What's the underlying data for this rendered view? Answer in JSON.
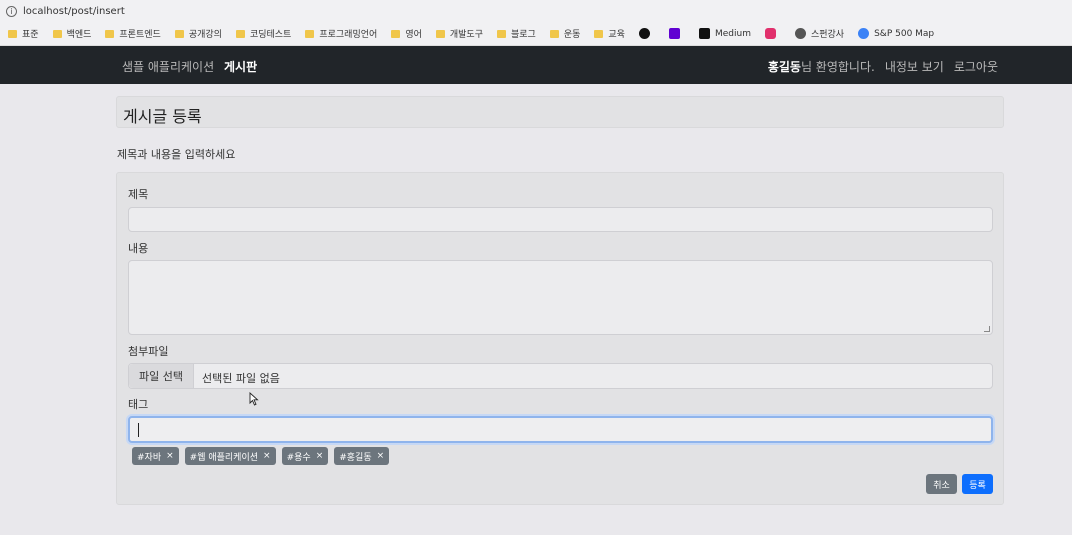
{
  "browser": {
    "url": "localhost/post/insert",
    "bookmarks": [
      {
        "label": "표준",
        "icon": "folder-icon"
      },
      {
        "label": "백엔드",
        "icon": "folder-icon"
      },
      {
        "label": "프론트엔드",
        "icon": "folder-icon"
      },
      {
        "label": "공개강의",
        "icon": "folder-icon"
      },
      {
        "label": "코딩테스트",
        "icon": "folder-icon"
      },
      {
        "label": "프로그래밍언어",
        "icon": "folder-icon"
      },
      {
        "label": "영어",
        "icon": "folder-icon"
      },
      {
        "label": "개발도구",
        "icon": "folder-icon"
      },
      {
        "label": "블로그",
        "icon": "folder-icon"
      },
      {
        "label": "운동",
        "icon": "folder-icon"
      },
      {
        "label": "교육",
        "icon": "folder-icon"
      },
      {
        "label": "",
        "icon": "github-icon"
      },
      {
        "label": "",
        "icon": "yahoo-icon"
      },
      {
        "label": "Medium",
        "icon": "medium-icon"
      },
      {
        "label": "",
        "icon": "instagram-icon"
      },
      {
        "label": "스펀강사",
        "icon": "globe-icon"
      },
      {
        "label": "S&P 500 Map",
        "icon": "map-icon"
      }
    ]
  },
  "nav": {
    "brand": "샘플 애플리케이션",
    "board": "게시판",
    "user_name": "홍길동",
    "welcome": "님 환영합니다.",
    "my_info": "내정보 보기",
    "logout": "로그아웃"
  },
  "page": {
    "title": "게시글 등록",
    "guide": "제목과 내용을 입력하세요"
  },
  "form": {
    "title_label": "제목",
    "title_value": "",
    "content_label": "내용",
    "content_value": "",
    "file_label": "첨부파일",
    "file_button": "파일 선택",
    "file_status": "선택된 파일 없음",
    "tag_label": "태그",
    "tag_value": "",
    "tags": [
      "#자바",
      "#웹 애플리케이션",
      "#용수",
      "#홍길동"
    ],
    "tag_remove": "×",
    "cancel": "취소",
    "submit": "등록"
  },
  "colors": {
    "navbar": "#212529",
    "primary": "#0d6efd",
    "secondary": "#6c757d"
  }
}
